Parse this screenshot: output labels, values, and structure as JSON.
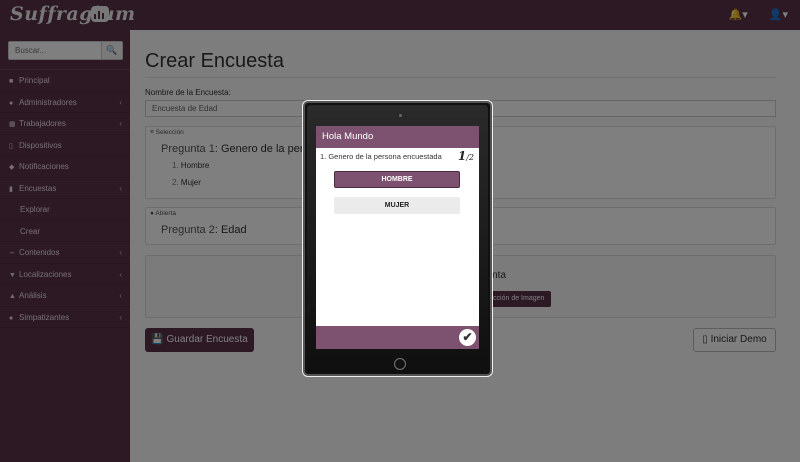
{
  "app": {
    "title": "Suffragium"
  },
  "topbar": {
    "bell_icon": "bell-icon",
    "user_icon": "user-icon"
  },
  "sidebar": {
    "search_placeholder": "Buscar...",
    "items": [
      {
        "label": "Principal",
        "icon": "dashboard-icon"
      },
      {
        "label": "Administradores",
        "icon": "user-icon"
      },
      {
        "label": "Trabajadores",
        "icon": "id-card-icon"
      },
      {
        "label": "Dispositivos",
        "icon": "tablet-icon"
      },
      {
        "label": "Notificaciones",
        "icon": "bell-icon"
      },
      {
        "label": "Encuestas",
        "icon": "file-icon"
      },
      {
        "label": "Explorar"
      },
      {
        "label": "Crear"
      },
      {
        "label": "Contenidos",
        "icon": "share-icon"
      },
      {
        "label": "Localizaciones",
        "icon": "map-marker-icon"
      },
      {
        "label": "Análisis",
        "icon": "chart-icon"
      },
      {
        "label": "Simpatizantes",
        "icon": "users-icon"
      }
    ]
  },
  "main": {
    "title": "Crear Encuesta",
    "name_label": "Nombre de la Encuesta:",
    "name_value": "Encuesta de Edad",
    "q1": {
      "tag": "Selección",
      "prefix": "Pregunta 1:",
      "text": "Genero de la persona",
      "opt1_num": "1.",
      "opt1": "Hombre",
      "opt2_num": "2.",
      "opt2": "Mujer"
    },
    "q2": {
      "tag": "Abierta",
      "prefix": "Pregunta 2:",
      "text": "Edad"
    },
    "add_fragment": "gunta",
    "image_button": "lección de Imagen",
    "save_button": "Guardar Encuesta",
    "demo_button": "Iniciar Demo"
  },
  "modal": {
    "header": "Hola Mundo",
    "question": "1. Genero de la persona encuestada",
    "counter_current": "1",
    "counter_total": "2",
    "answer1": "HOMBRE",
    "answer2": "MUJER"
  },
  "colors": {
    "brand": "#5a3248",
    "accent": "#7d5270"
  }
}
